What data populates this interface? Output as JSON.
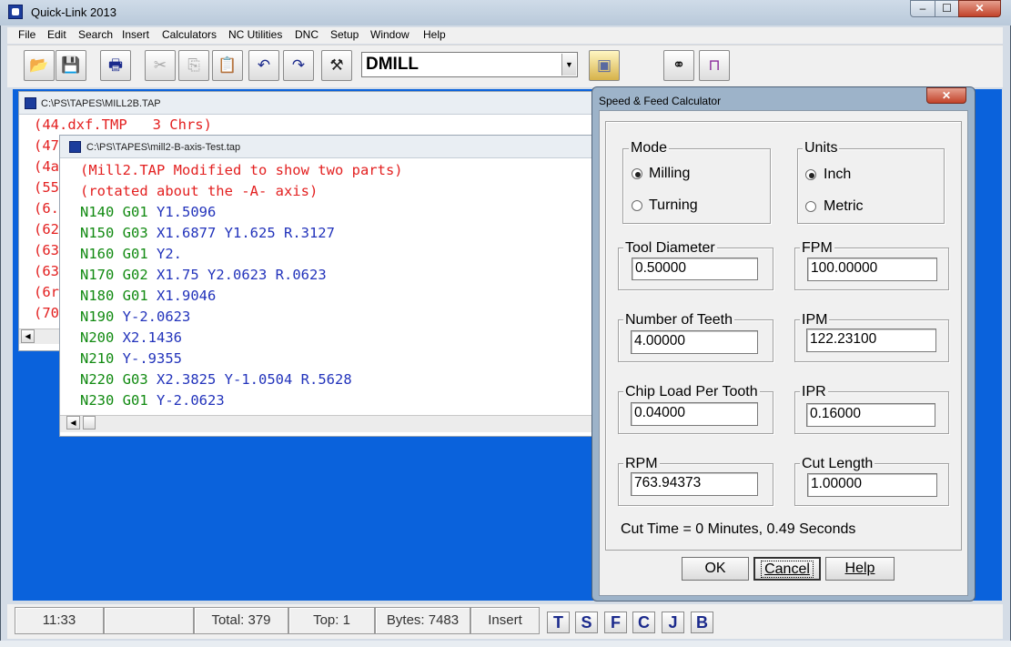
{
  "window": {
    "title": "Quick-Link 2013",
    "min": "–",
    "max": "☐",
    "close": "✕"
  },
  "menu": [
    "File",
    "Edit",
    "Search",
    "Insert",
    "Calculators",
    "NC Utilities",
    "DNC",
    "Setup",
    "Window",
    "Help"
  ],
  "toolbar": {
    "open_icon": "📂",
    "save_icon": "💾",
    "print_icon": "🖶",
    "cut_icon": "✂",
    "copy_icon": "⎘",
    "paste_icon": "📋",
    "undo_icon": "↶",
    "redo_icon": "↷",
    "tool_icon": "⚒",
    "machine_combo_value": "DMILL",
    "combo_arrow": "▼",
    "post_icon": "▣",
    "find_icon": "⚭",
    "dnc_icon": "⊓"
  },
  "doc1": {
    "title": "C:\\PS\\TAPES\\MILL2B.TAP",
    "lines": [
      "(44.dxf.TMP   3 Chrs)",
      "(47",
      "(4a",
      "(55",
      "(6.",
      "(62",
      "(63",
      "(63",
      "(6r",
      "(70"
    ],
    "scroll_left": "◀"
  },
  "doc2": {
    "title": "C:\\PS\\TAPES\\mill2-B-axis-Test.tap",
    "comment1": "(Mill2.TAP Modified to show two parts)",
    "comment2": "(rotated about the -A- axis)",
    "lines": [
      [
        [
          "N140 G01 ",
          "g"
        ],
        [
          "Y1.5096",
          "b"
        ]
      ],
      [
        [
          "N150 G03 ",
          "g"
        ],
        [
          "X1.6877 ",
          "b"
        ],
        [
          "Y1.625 ",
          "b"
        ],
        [
          "R.3127",
          "b"
        ]
      ],
      [
        [
          "N160 G01 ",
          "g"
        ],
        [
          "Y2.",
          "b"
        ]
      ],
      [
        [
          "N170 G02 ",
          "g"
        ],
        [
          "X1.75 ",
          "b"
        ],
        [
          "Y2.0623 ",
          "b"
        ],
        [
          "R.0623",
          "b"
        ]
      ],
      [
        [
          "N180 G01 ",
          "g"
        ],
        [
          "X1.9046",
          "b"
        ]
      ],
      [
        [
          "N190 ",
          "g"
        ],
        [
          "Y-2.0623",
          "b"
        ]
      ],
      [
        [
          "N200 ",
          "g"
        ],
        [
          "X2.1436",
          "b"
        ]
      ],
      [
        [
          "N210 ",
          "g"
        ],
        [
          "Y-.9355",
          "b"
        ]
      ],
      [
        [
          "N220 G03 ",
          "g"
        ],
        [
          "X2.3825 ",
          "b"
        ],
        [
          "Y-1.0504 ",
          "b"
        ],
        [
          "R.5628",
          "b"
        ]
      ],
      [
        [
          "N230 G01 ",
          "g"
        ],
        [
          "Y-2.0623",
          "b"
        ]
      ]
    ],
    "scroll_left": "◀"
  },
  "dialog": {
    "title": "Speed & Feed Calculator",
    "close": "✕",
    "mode": {
      "label": "Mode",
      "options": [
        "Milling",
        "Turning"
      ],
      "selected": "Milling"
    },
    "units": {
      "label": "Units",
      "options": [
        "Inch",
        "Metric"
      ],
      "selected": "Inch"
    },
    "tool_diameter": {
      "label": "Tool Diameter",
      "value": "0.50000"
    },
    "fpm": {
      "label": "FPM",
      "value": "100.00000"
    },
    "teeth": {
      "label": "Number of Teeth",
      "value": "4.00000"
    },
    "ipm": {
      "label": "IPM",
      "value": "122.23100"
    },
    "chip_load": {
      "label": "Chip Load Per Tooth",
      "value": "0.04000"
    },
    "ipr": {
      "label": "IPR",
      "value": "0.16000"
    },
    "rpm": {
      "label": "RPM",
      "value": "763.94373"
    },
    "cut_length": {
      "label": "Cut Length",
      "value": "1.00000"
    },
    "cut_time": "Cut Time = 0 Minutes, 0.49 Seconds",
    "ok": "OK",
    "cancel": "Cancel",
    "help": "Help"
  },
  "status": {
    "time": "11:33",
    "blank": "",
    "total": "Total: 379",
    "top": "Top: 1",
    "bytes": "Bytes: 7483",
    "mode": "Insert",
    "buttons": [
      "T",
      "S",
      "F",
      "C",
      "J",
      "B"
    ]
  }
}
